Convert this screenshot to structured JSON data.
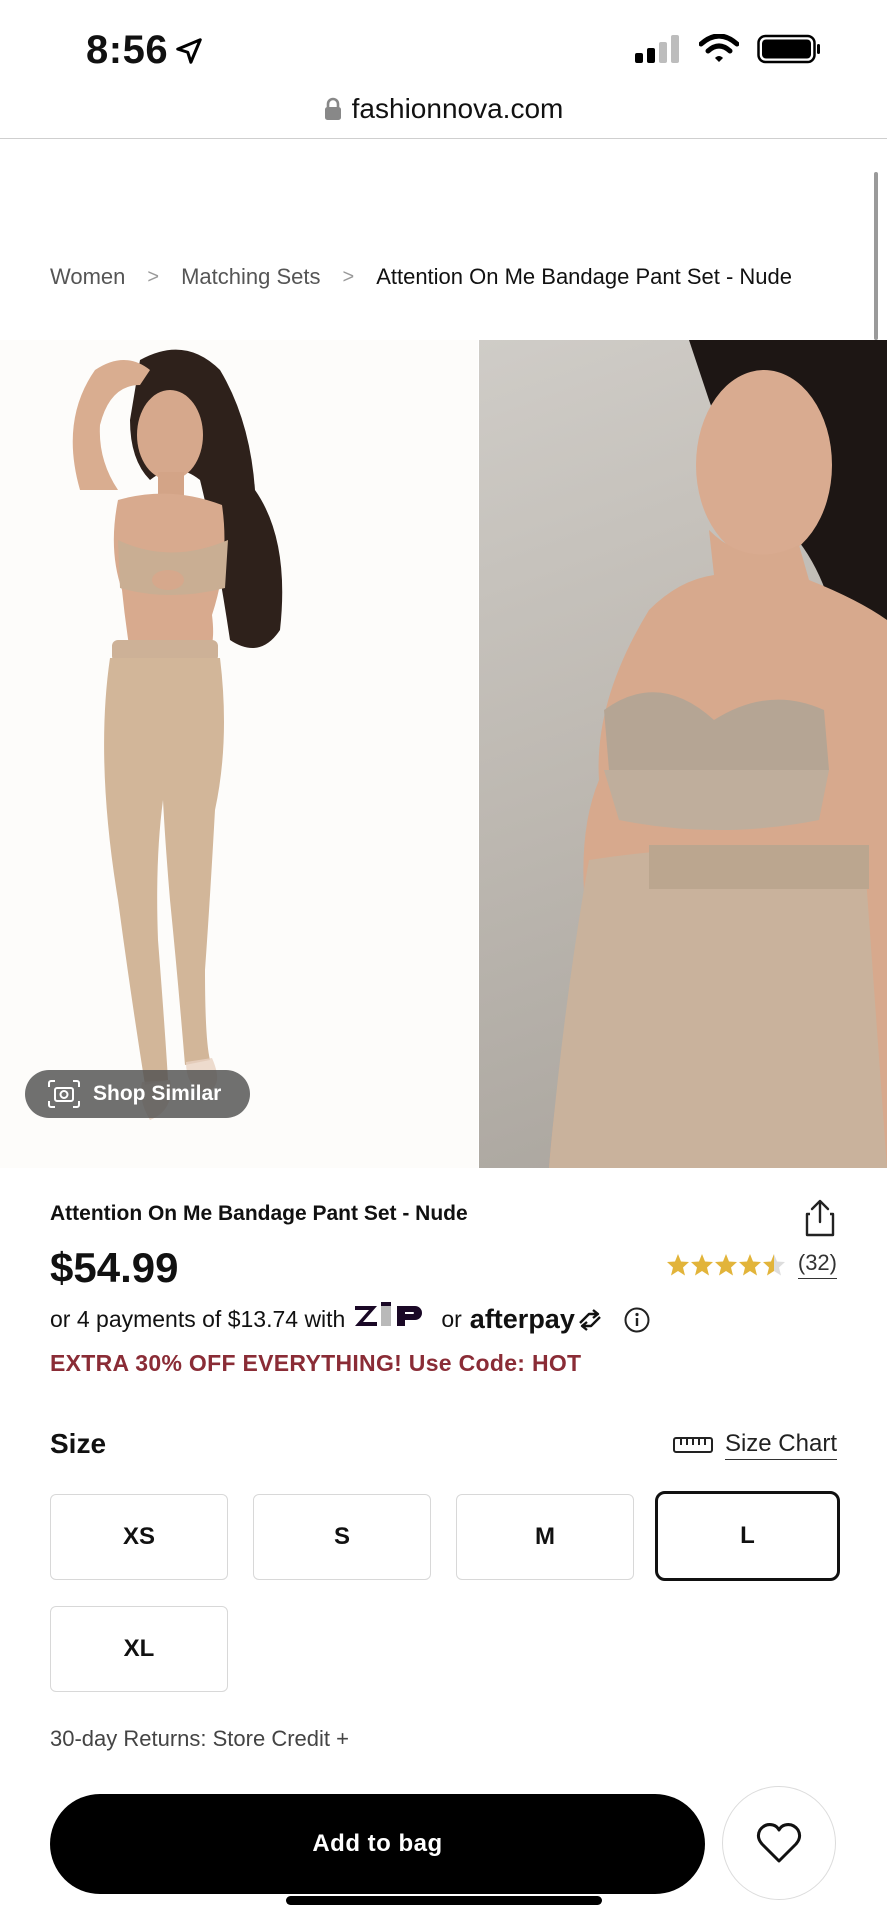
{
  "status_bar": {
    "time": "8:56"
  },
  "browser": {
    "url": "fashionnova.com"
  },
  "breadcrumb": [
    {
      "label": "Women"
    },
    {
      "label": "Matching Sets"
    },
    {
      "label": "Attention On Me Bandage Pant Set - Nude"
    }
  ],
  "gallery": {
    "shop_similar_label": "Shop Similar"
  },
  "product": {
    "title": "Attention On Me Bandage Pant Set - Nude",
    "price": "$54.99",
    "rating_stars": 4.5,
    "review_count": "(32)",
    "payments": {
      "prefix": "or 4 payments of $13.74 with",
      "zip_logo": "ZIP",
      "or": "or",
      "afterpay_logo": "afterpay"
    },
    "promo": "EXTRA 30% OFF EVERYTHING! Use Code: HOT"
  },
  "size": {
    "label": "Size",
    "chart_label": "Size Chart",
    "options": [
      "XS",
      "S",
      "M",
      "L",
      "XL"
    ],
    "selected": "L"
  },
  "returns": "30-day Returns: Store Credit +",
  "actions": {
    "add_to_bag": "Add to bag"
  },
  "colors": {
    "promo": "#8a2c36",
    "star": "#e2b43a",
    "button": "#000000"
  }
}
